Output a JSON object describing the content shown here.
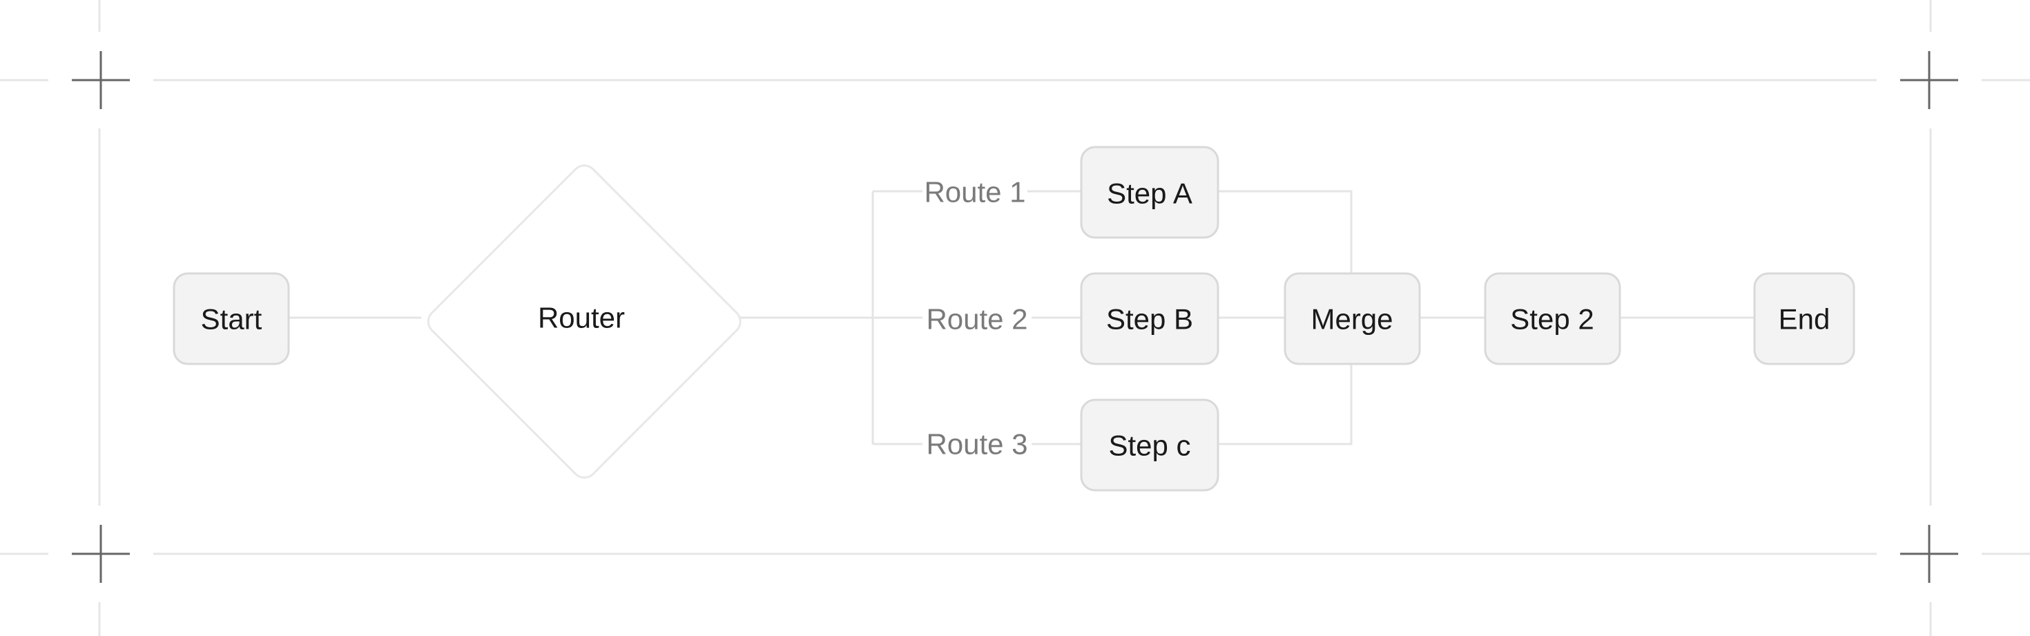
{
  "diagram": {
    "nodes": {
      "start": "Start",
      "router": "Router",
      "step_a": "Step A",
      "step_b": "Step B",
      "step_c": "Step c",
      "merge": "Merge",
      "step_2": "Step 2",
      "end": "End"
    },
    "routes": {
      "route_1": "Route 1",
      "route_2": "Route 2",
      "route_3": "Route 3"
    }
  },
  "colors": {
    "node_fill": "#f3f3f3",
    "node_stroke": "#d9d9d9",
    "edge": "#e4e4e4",
    "frame_line": "#e6e6e6",
    "crosshair": "#666666",
    "node_text": "#1a1a1a",
    "route_text": "#7a7a7a"
  }
}
